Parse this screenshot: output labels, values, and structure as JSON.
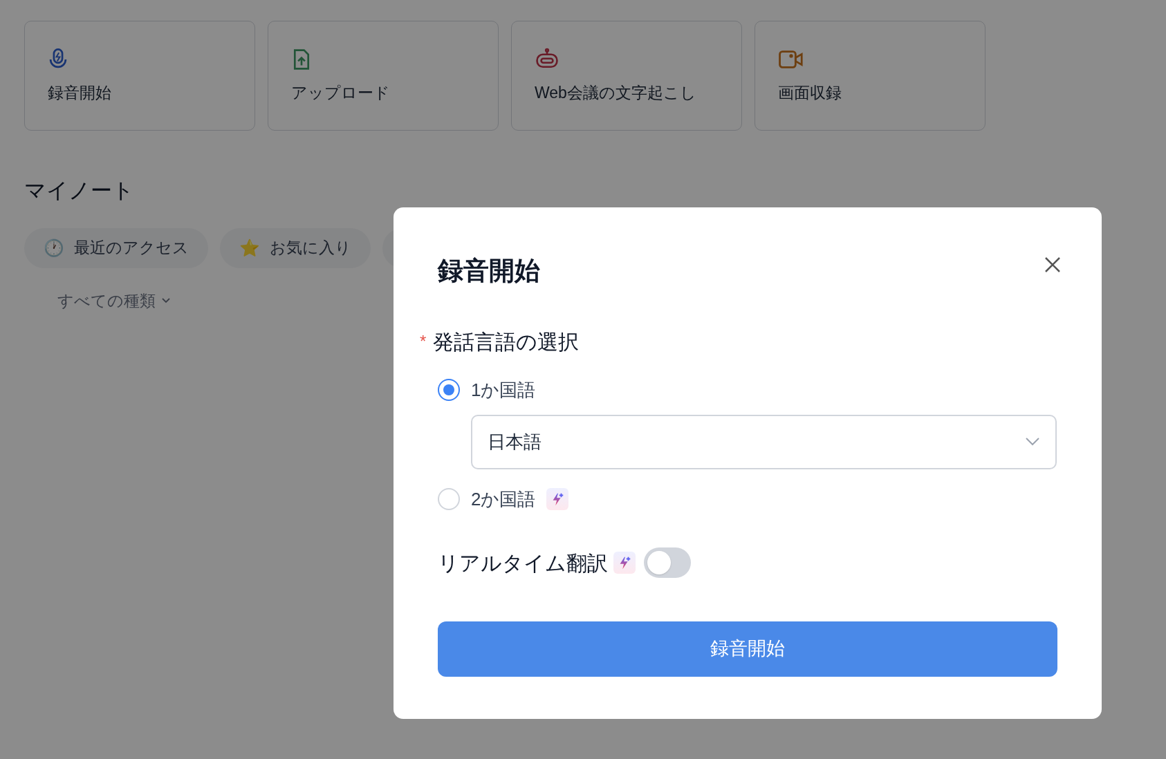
{
  "actions": [
    {
      "kind": "mic",
      "label": "録音開始"
    },
    {
      "kind": "upload",
      "label": "アップロード"
    },
    {
      "kind": "bot",
      "label": "Web会議の文字起こし"
    },
    {
      "kind": "video",
      "label": "画面収録"
    }
  ],
  "notes": {
    "title": "マイノート",
    "filters": [
      {
        "icon": "🕐",
        "label": "最近のアクセス"
      },
      {
        "icon": "⭐",
        "label": "お気に入り"
      },
      {
        "cut_off": true
      }
    ],
    "type_filter": "すべての種類"
  },
  "dialog": {
    "title": "録音開始",
    "required_mark": "*",
    "field_label": "発話言語の選択",
    "options": [
      {
        "label": "1か国語",
        "selected": true,
        "premium": false
      },
      {
        "label": "2か国語",
        "selected": false,
        "premium": true
      }
    ],
    "language": "日本語",
    "realtime": {
      "label": "リアルタイム翻訳",
      "premium": true,
      "on": false
    },
    "submit": "録音開始"
  }
}
